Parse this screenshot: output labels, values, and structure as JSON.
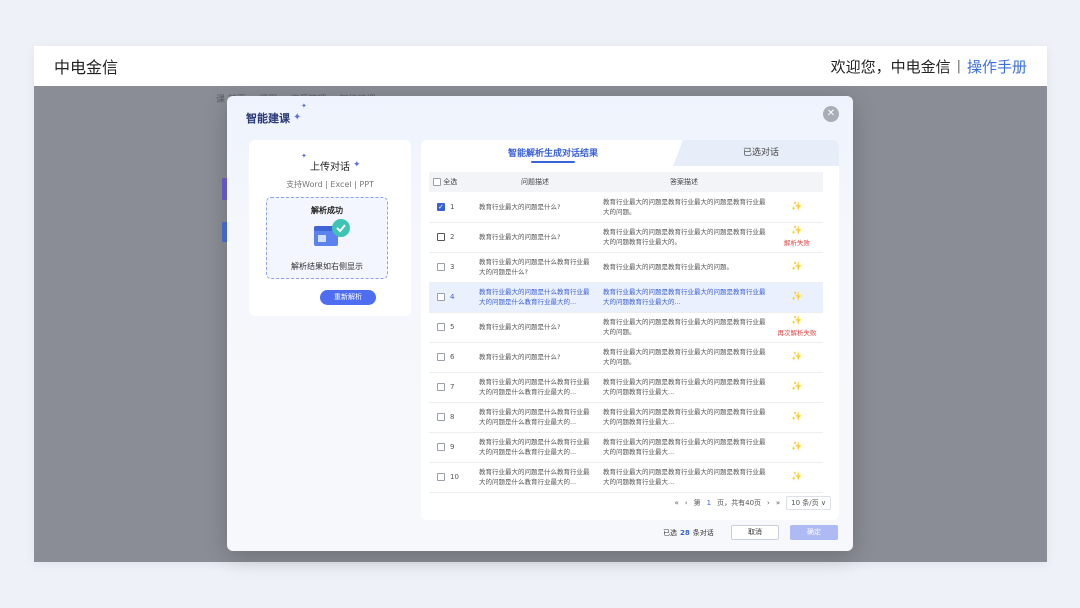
{
  "header": {
    "brand": "中电金信",
    "welcome": "欢迎您，中电金信",
    "separator": "|",
    "manual": "操作手册"
  },
  "background": {
    "breadcrumb": "课 首页 > 课程 > 资源管理 > 智能建课"
  },
  "modal": {
    "title": "智能建课",
    "left": {
      "title": "上传对话",
      "formats": "支持Word | Excel | PPT",
      "status": "解析成功",
      "message": "解析结果如右侧显示",
      "reparse_label": "重新解析"
    },
    "tabs": {
      "active": "智能解析生成对话结果",
      "other": "已选对话"
    },
    "table": {
      "headers": {
        "select_all": "全选",
        "question": "问题描述",
        "answer": "答案描述"
      },
      "rows": [
        {
          "n": "1",
          "checked": true,
          "q": "教育行业最大的问题是什么?",
          "a": "教育行业最大的问题是教育行业最大的问题是教育行业最大的问题。",
          "note": ""
        },
        {
          "n": "2",
          "checked": false,
          "q": "教育行业最大的问题是什么?",
          "a": "教育行业最大的问题是教育行业最大的问题是教育行业最大的问题教育行业最大的。",
          "note": "解析失败"
        },
        {
          "n": "3",
          "checked": false,
          "q": "教育行业最大的问题是什么教育行业最大的问题是什么?",
          "a": "教育行业最大的问题是教育行业最大的问题。",
          "note": ""
        },
        {
          "n": "4",
          "checked": false,
          "q": "教育行业最大的问题是什么教育行业最大的问题是什么教育行业最大的...",
          "a": "教育行业最大的问题是教育行业最大的问题是教育行业最大的问题教育行业最大的...",
          "note": ""
        },
        {
          "n": "5",
          "checked": false,
          "q": "教育行业最大的问题是什么?",
          "a": "教育行业最大的问题是教育行业最大的问题是教育行业最大的问题。",
          "note": "再次解析失败"
        },
        {
          "n": "6",
          "checked": false,
          "q": "教育行业最大的问题是什么?",
          "a": "教育行业最大的问题是教育行业最大的问题是教育行业最大的问题。",
          "note": ""
        },
        {
          "n": "7",
          "checked": false,
          "q": "教育行业最大的问题是什么教育行业最大的问题是什么教育行业最大的...",
          "a": "教育行业最大的问题是教育行业最大的问题是教育行业最大的问题教育行业最大...",
          "note": ""
        },
        {
          "n": "8",
          "checked": false,
          "q": "教育行业最大的问题是什么教育行业最大的问题是什么教育行业最大的...",
          "a": "教育行业最大的问题是教育行业最大的问题是教育行业最大的问题教育行业最大...",
          "note": ""
        },
        {
          "n": "9",
          "checked": false,
          "q": "教育行业最大的问题是什么教育行业最大的问题是什么教育行业最大的...",
          "a": "教育行业最大的问题是教育行业最大的问题是教育行业最大的问题教育行业最大...",
          "note": ""
        },
        {
          "n": "10",
          "checked": false,
          "q": "教育行业最大的问题是什么教育行业最大的问题是什么教育行业最大的...",
          "a": "教育行业最大的问题是教育行业最大的问题是教育行业最大的问题教育行业最大...",
          "note": ""
        }
      ]
    },
    "pager": {
      "first": "«",
      "prev": "‹",
      "page_prefix": "第",
      "current": "1",
      "page_suffix": "页，共有40页",
      "next": "›",
      "last": "»",
      "size": "10 条/页 ∨"
    },
    "footer": {
      "sel_prefix": "已选",
      "sel_count": "28",
      "sel_suffix": "条对话",
      "cancel": "取消",
      "ok": "确定"
    }
  },
  "colors": {
    "accent": "#3b63d8",
    "error": "#e34848",
    "overlay": "#8a8d95"
  },
  "icons": {
    "close": "close-icon",
    "wand": "magic-wand-icon",
    "sparkle": "sparkle-icon",
    "file": "file-success-icon"
  }
}
